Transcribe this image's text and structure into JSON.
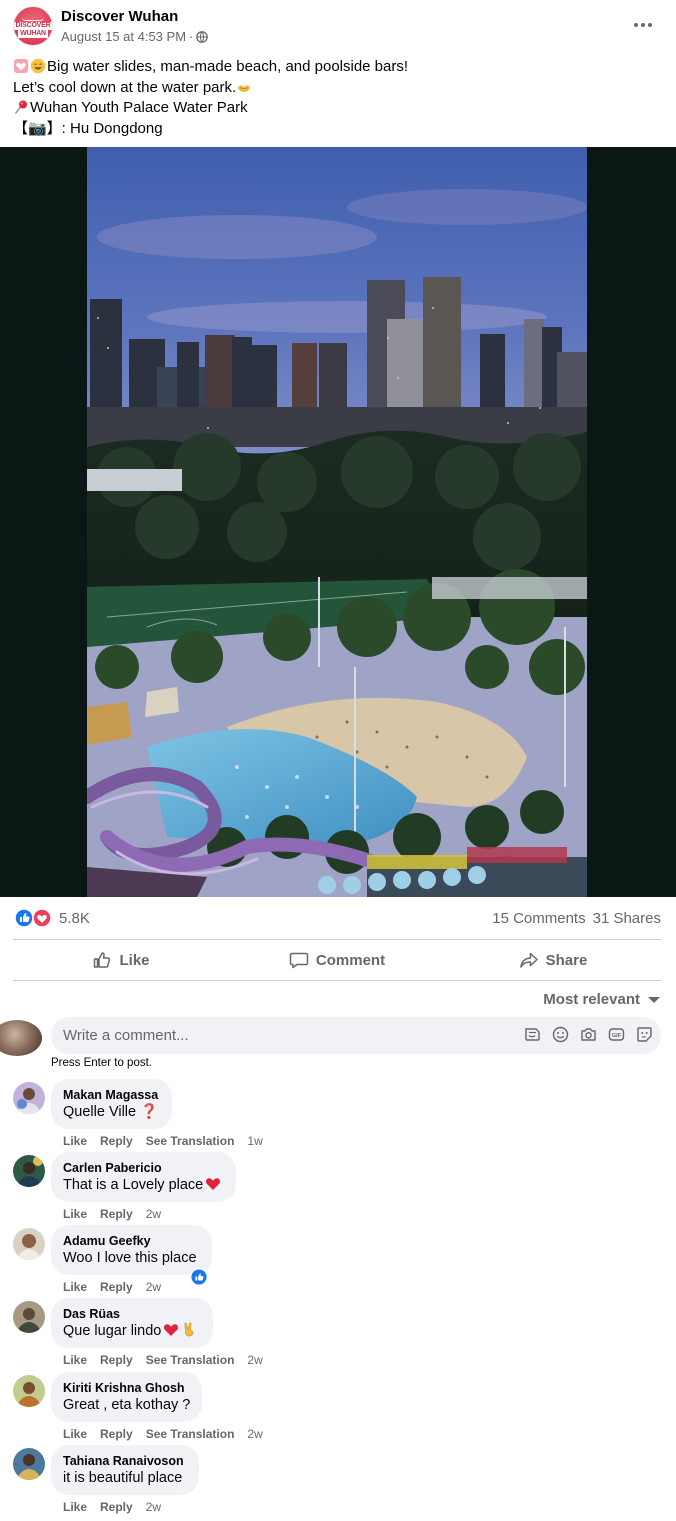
{
  "post": {
    "page_name": "Discover Wuhan",
    "avatar_text_top": "DISCOVER",
    "avatar_text_bottom": "WUHAN",
    "time": "August 15 at 4:53 PM",
    "time_sep": "·",
    "privacy_icon": "globe-icon",
    "more_icon": "more-options-icon",
    "lines": [
      "Big water slides, man-made beach, and poolside bars!",
      "Let’s cool down at the water park.",
      "Wuhan Youth Palace Water Park",
      "【📷】: Hu Dongdong"
    ],
    "line_icons": [
      "heart-emoji-icon",
      "smile-emoji-icon",
      "hands-emoji-icon",
      "pin-emoji-icon"
    ]
  },
  "reactions": {
    "icons": [
      "like-reaction-icon",
      "love-reaction-icon"
    ],
    "count": "5.8K",
    "comments": "15 Comments",
    "shares": "31 Shares"
  },
  "actions": {
    "like": "Like",
    "comment": "Comment",
    "share": "Share"
  },
  "sort": {
    "label": "Most relevant"
  },
  "composer": {
    "placeholder": "Write a comment...",
    "hint": "Press Enter to post.",
    "tools": [
      "sticker-icon",
      "emoji-icon",
      "camera-icon",
      "gif-icon",
      "avatar-sticker-icon"
    ]
  },
  "comments": [
    {
      "author": "Makan Magassa",
      "text": "Quelle Ville ❓",
      "like": "Like",
      "reply": "Reply",
      "translate": "See Translation",
      "time": "1w"
    },
    {
      "author": "Carlen Pabericio",
      "text": "That is a Lovely place",
      "like": "Like",
      "reply": "Reply",
      "translate": "",
      "time": "2w"
    },
    {
      "author": "Adamu Geefky",
      "text": "Woo I love this place",
      "like": "Like",
      "reply": "Reply",
      "translate": "",
      "time": "2w"
    },
    {
      "author": "Das Rüas",
      "text": "Que lugar lindo",
      "like": "Like",
      "reply": "Reply",
      "translate": "See Translation",
      "time": "2w"
    },
    {
      "author": "Kiriti Krishna Ghosh",
      "text": "Great , eta kothay ?",
      "like": "Like",
      "reply": "Reply",
      "translate": "See Translation",
      "time": "2w"
    },
    {
      "author": "Tahiana Ranaivoson",
      "text": "it is beautiful place",
      "like": "Like",
      "reply": "Reply",
      "translate": "",
      "time": "2w"
    }
  ],
  "colors": {
    "secondary_text": "#65676b",
    "bubble": "#f0f2f5",
    "like_blue": "#1877f2",
    "love_red": "#f33e58"
  }
}
